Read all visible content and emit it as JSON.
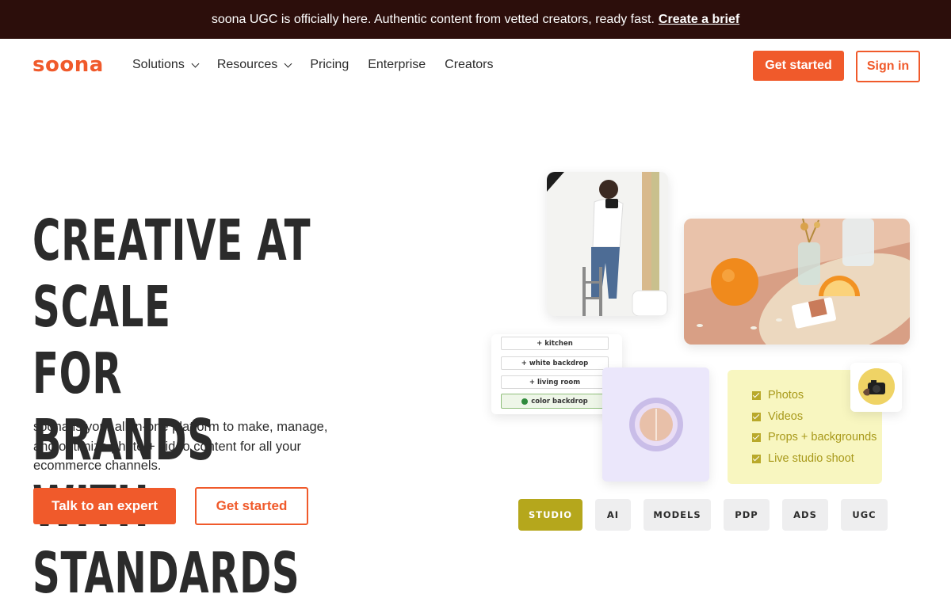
{
  "announcement": {
    "text": "soona UGC is officially here. Authentic content from vetted creators, ready fast.",
    "link": "Create a brief"
  },
  "nav": {
    "logo": "soona",
    "items": [
      {
        "label": "Solutions",
        "dropdown": true
      },
      {
        "label": "Resources",
        "dropdown": true
      },
      {
        "label": "Pricing",
        "dropdown": false
      },
      {
        "label": "Enterprise",
        "dropdown": false
      },
      {
        "label": "Creators",
        "dropdown": false
      }
    ],
    "get_started": "Get started",
    "sign_in": "Sign in"
  },
  "hero": {
    "headline": "CREATIVE AT SCALE\nFOR BRANDS WITH\nSTANDARDS",
    "subtext": "soona is your all-in-one platform to make, manage, and optimize photo + video content for all your ecommerce channels.",
    "cta_primary": "Talk to an expert",
    "cta_secondary": "Get started"
  },
  "collage": {
    "tags": [
      "kitchen",
      "white backdrop",
      "living room",
      "color backdrop"
    ],
    "checklist": [
      "Photos",
      "Videos",
      "Props + backgrounds",
      "Live studio shoot"
    ]
  },
  "pills": [
    {
      "label": "STUDIO",
      "active": true
    },
    {
      "label": "AI",
      "active": false
    },
    {
      "label": "MODELS",
      "active": false
    },
    {
      "label": "PDP",
      "active": false
    },
    {
      "label": "ADS",
      "active": false
    },
    {
      "label": "UGC",
      "active": false
    }
  ],
  "colors": {
    "brand": "#f05a2b",
    "announcement_bg": "#2c0e0b",
    "active_pill": "#b5a71c",
    "checklist_bg": "#f8f6c0"
  }
}
